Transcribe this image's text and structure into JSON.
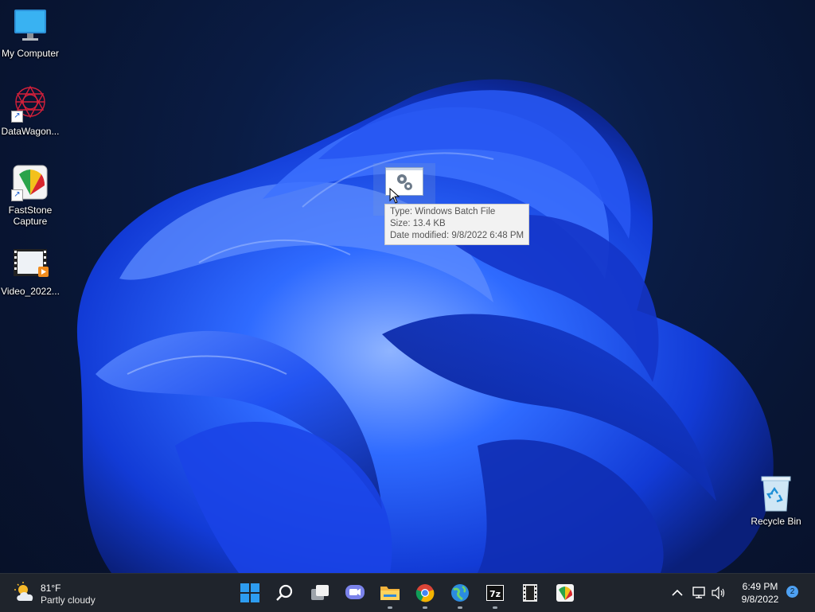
{
  "desktop": {
    "icons": [
      {
        "label": "My Computer",
        "icon": "monitor-icon"
      },
      {
        "label": "DataWagon...",
        "icon": "datawagon-app-icon"
      },
      {
        "label": "FastStone Capture",
        "icon": "faststone-capture-icon"
      },
      {
        "label": "Video_2022...",
        "icon": "video-file-icon"
      }
    ],
    "recycle_bin": {
      "label": "Recycle Bin",
      "icon": "recycle-bin-icon"
    }
  },
  "dragged_file": {
    "icon": "batch-file-icon",
    "tooltip": {
      "type": "Type: Windows Batch File",
      "size": "Size: 13.4 KB",
      "modified": "Date modified: 9/8/2022 6:48 PM"
    }
  },
  "taskbar": {
    "weather": {
      "temp": "81°F",
      "condition": "Partly cloudy",
      "icon": "partly-cloudy-icon"
    },
    "apps": [
      {
        "name": "start",
        "icon": "windows-start-icon"
      },
      {
        "name": "search",
        "icon": "search-icon"
      },
      {
        "name": "task-view",
        "icon": "task-view-icon"
      },
      {
        "name": "chat",
        "icon": "teams-chat-icon"
      },
      {
        "name": "file-explorer",
        "icon": "folder-icon",
        "running": true
      },
      {
        "name": "chrome",
        "icon": "chrome-icon",
        "running": true
      },
      {
        "name": "edge",
        "icon": "globe-icon",
        "running": true
      },
      {
        "name": "7zip",
        "icon": "7zip-icon",
        "running": true
      },
      {
        "name": "video-editor",
        "icon": "film-icon"
      },
      {
        "name": "faststone",
        "icon": "faststone-taskbar-icon"
      }
    ],
    "tray": {
      "chevron": "chevron-up-icon",
      "network": "network-icon",
      "volume": "volume-icon",
      "time": "6:49 PM",
      "date": "9/8/2022",
      "notifications": "2"
    }
  },
  "colors": {
    "taskbar": "#1f242c",
    "accent": "#4ea1f3",
    "bloom": "#1f4fff"
  }
}
